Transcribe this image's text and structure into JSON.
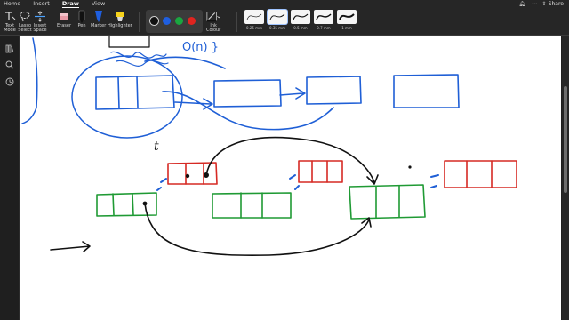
{
  "menu": {
    "items": [
      "Home",
      "Insert",
      "Draw",
      "View"
    ],
    "active": "Draw",
    "share_label": "Share"
  },
  "ribbon": {
    "text_mode": {
      "line1": "Text",
      "line2": "Mode"
    },
    "lasso_select": {
      "line1": "Lasso",
      "line2": "Select"
    },
    "insert_space": {
      "line1": "Insert",
      "line2": "Space"
    },
    "eraser": "Eraser",
    "pen": "Pen",
    "marker": "Marker",
    "highlighter": "Highlighter",
    "colors": [
      {
        "name": "black",
        "hex": "#111111",
        "selected": true
      },
      {
        "name": "blue",
        "hex": "#1f5fe0",
        "selected": false
      },
      {
        "name": "green",
        "hex": "#1aa640",
        "selected": false
      },
      {
        "name": "red",
        "hex": "#e0241f",
        "selected": false
      }
    ],
    "ink_colour": {
      "line1": "Ink",
      "line2": "Colour"
    },
    "thicknesses": [
      {
        "label": "0.25 mm",
        "selected": false
      },
      {
        "label": "0.35 mm",
        "selected": true
      },
      {
        "label": "0.5 mm",
        "selected": false
      },
      {
        "label": "0.7 mm",
        "selected": false
      },
      {
        "label": "1 mm",
        "selected": false
      }
    ]
  },
  "sidebar": {
    "icons": [
      "library-icon",
      "search-icon",
      "history-icon"
    ]
  },
  "canvas": {
    "ink_colors": {
      "blue": "#1f5fd6",
      "red": "#d62a24",
      "green": "#1f9a34",
      "black": "#111111"
    },
    "handwritten_text": {
      "o_notation": "O(n) }",
      "annotation": "t"
    }
  }
}
